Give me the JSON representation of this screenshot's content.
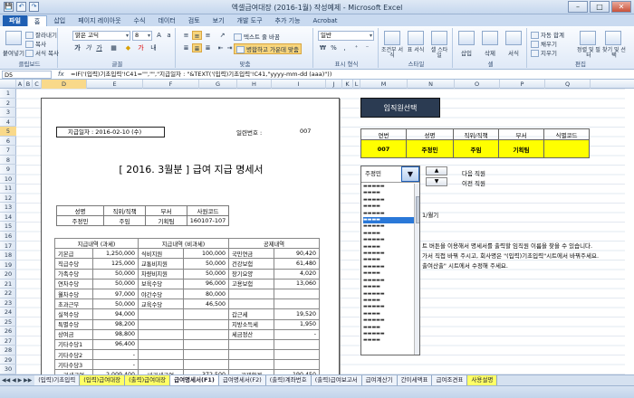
{
  "window": {
    "title": "엑셀급여대장 (2016-1월) 작성예제 - Microsoft Excel"
  },
  "qat": [
    "💾",
    "↶",
    "↷"
  ],
  "ribbon_tabs": [
    "파일",
    "홈",
    "삽입",
    "페이지 레이아웃",
    "수식",
    "데이터",
    "검토",
    "보기",
    "개발 도구",
    "추가 기능",
    "Acrobat"
  ],
  "ribbon": {
    "clipboard": {
      "name": "클립보드",
      "paste": "붙여넣기",
      "cut": "잘라내기",
      "copy": "복사",
      "format_painter": "서식 복사"
    },
    "font": {
      "name": "글꼴",
      "face": "맑은 고딕",
      "size": "8"
    },
    "align": {
      "name": "맞춤",
      "wrap": "텍스트 줄 바꿈",
      "merge": "병합하고 가운데 맞춤"
    },
    "number": {
      "name": "표시 형식",
      "format": "일반"
    },
    "style": {
      "name": "스타일",
      "cond": "조건부 서식",
      "table": "표 서식",
      "cell": "셀 스타일"
    },
    "cells": {
      "name": "셀",
      "insert": "삽입",
      "delete": "삭제",
      "format": "서식"
    },
    "edit": {
      "name": "편집",
      "autosum": "자동 합계",
      "fill": "채우기",
      "clear": "지우기",
      "sort": "정렬 및 필터",
      "find": "찾기 및 선택"
    }
  },
  "formula_bar": {
    "namebox": "D5",
    "fx": "fx",
    "formula": "=IF('(입력)기초입력'!C41=\"\",\"\",\"지급일자 : \"&TEXT('(입력)기초입력'!C41,\"yyyy-mm-dd (aaa)\"))"
  },
  "columns": [
    "A",
    "B",
    "C",
    "D",
    "E",
    "F",
    "G",
    "H",
    "I",
    "J",
    "K",
    "L",
    "M",
    "N",
    "O",
    "P",
    "Q"
  ],
  "rows": [
    "1",
    "2",
    "3",
    "4",
    "5",
    "6",
    "7",
    "8",
    "9",
    "10",
    "11",
    "12",
    "13",
    "14",
    "15",
    "16",
    "17",
    "18",
    "19",
    "20",
    "21",
    "22",
    "23",
    "24",
    "25",
    "26",
    "27",
    "28",
    "29",
    "30"
  ],
  "payslip": {
    "paydate": "지급일자 : 2016-02-10 (수)",
    "seq_label": "일련번호 :",
    "seq_value": "007",
    "title": "[ 2016. 3월분 ] 급여 지급 명세서",
    "emp_headers": [
      "성명",
      "직위/직책",
      "부서",
      "사원코드"
    ],
    "emp_values": [
      "주정민",
      "주임",
      "기획팀",
      "160107-107"
    ],
    "sections": [
      "지급내역 (과세)",
      "지급내역 (비과세)",
      "공제내역"
    ],
    "rows": [
      [
        "기본급",
        "1,250,000",
        "식비지원",
        "100,000",
        "국민연금",
        "90,420"
      ],
      [
        "직급수당",
        "125,000",
        "교통비지원",
        "50,000",
        "건강보험",
        "61,480"
      ],
      [
        "가족수당",
        "50,000",
        "차량비지원",
        "50,000",
        "장기요양",
        "4,020"
      ],
      [
        "연차수당",
        "50,000",
        "보육수당",
        "96,000",
        "고용보험",
        "13,060"
      ],
      [
        "월차수당",
        "97,000",
        "야간수당",
        "80,000",
        "",
        ""
      ],
      [
        "초과근무",
        "50,000",
        "교육수당",
        "46,500",
        "",
        ""
      ],
      [
        "실적수당",
        "94,000",
        "",
        "",
        "갑근세",
        "19,520"
      ],
      [
        "특별수당",
        "98,200",
        "",
        "",
        "지방소득세",
        "1,950"
      ],
      [
        "상여금",
        "98,800",
        "",
        "",
        "세금정산",
        "-"
      ],
      [
        "기타수당1",
        "96,400",
        "",
        "",
        "",
        ""
      ],
      [
        "기타수당2",
        "-",
        "",
        "",
        "",
        ""
      ],
      [
        "기타수당3",
        "-",
        "",
        "",
        "",
        ""
      ]
    ],
    "totals": [
      "과세급여",
      "2,009,400",
      "비과세급여",
      "372,500",
      "공제합계",
      "190,450"
    ]
  },
  "panel": {
    "select_button": "임직원선택",
    "headers": [
      "연번",
      "성명",
      "직위/직책",
      "부서",
      "식별코드"
    ],
    "values": [
      "007",
      "주정민",
      "주임",
      "기획팀",
      ""
    ],
    "dropdown_value": "주정민",
    "next": "다음 직원",
    "prev": "이전 직원",
    "partial_month": "1/월기",
    "note1": "트 버튼을 이용해서 명세서를 출력할 임직원 이름을 찾을 수 있습니다.",
    "note2": "가서 직접 바꿔 주시고, 회사명은 \"(입력)기초입력\"시트에서 바꿔주세요.",
    "note3": "출여산출\" 시트에서 수정해 주세요."
  },
  "sheet_tabs": [
    {
      "label": "(입력)기초입력",
      "style": ""
    },
    {
      "label": "(입력)급여대장",
      "style": "yel"
    },
    {
      "label": "(출력)급여대장",
      "style": "yel"
    },
    {
      "label": "급여명세서(F1)",
      "style": "active"
    },
    {
      "label": "급여명세서(F2)",
      "style": ""
    },
    {
      "label": "(출력)계좌번호",
      "style": ""
    },
    {
      "label": "(출력)급여보고서",
      "style": ""
    },
    {
      "label": "급여계산기",
      "style": ""
    },
    {
      "label": "간이세액표",
      "style": ""
    },
    {
      "label": "급여조견표",
      "style": ""
    },
    {
      "label": "사용설명",
      "style": "yel"
    }
  ]
}
